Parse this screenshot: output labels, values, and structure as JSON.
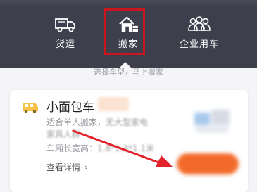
{
  "nav": {
    "tabs": [
      {
        "label": "货运",
        "icon": "truck-icon"
      },
      {
        "label": "搬家",
        "icon": "house-icon"
      },
      {
        "label": "企业用车",
        "icon": "group-icon"
      }
    ],
    "selected": "搬家",
    "highlight_color": "#c9151e",
    "bg_color": "#3d3f4c"
  },
  "hint": "选择车型，马上搬家",
  "card": {
    "title": "小面包车",
    "desc_visible": "适合单人搬家，",
    "desc_blurred_1": "无大型家电",
    "desc_blurred_2": "家具人群",
    "dims_label": "车厢长宽高：",
    "dims_value": "1.8*1.3*1.1米",
    "details": "查看详情",
    "details_chevron": "›",
    "icon": "van-icon",
    "accent_color": "#f26a2a"
  },
  "annotation": {
    "arrow_color": "#e3222b"
  }
}
